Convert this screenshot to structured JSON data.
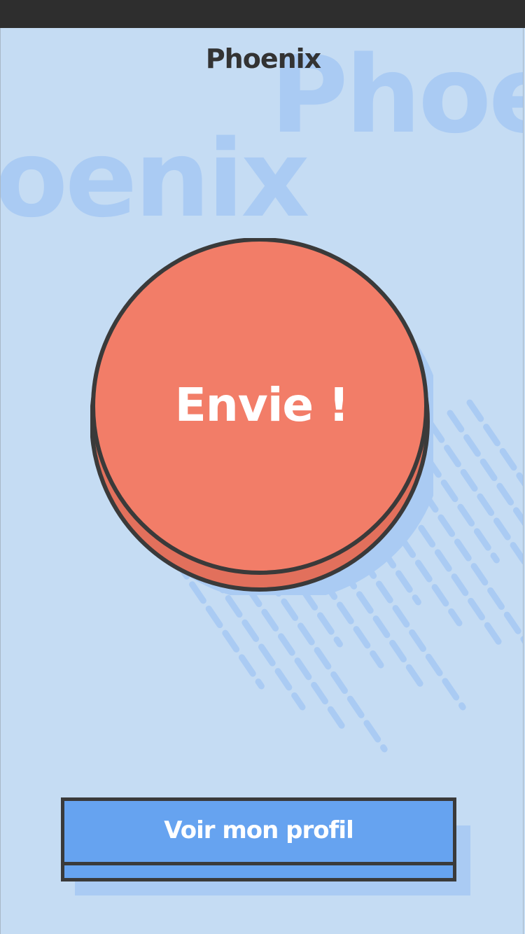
{
  "app": {
    "title": "Phoenix",
    "background_watermark": "Phoenix"
  },
  "main": {
    "envie_button_label": "Envie !",
    "profile_button_label": "Voir mon profil"
  },
  "colors": {
    "background": "#c5dcf3",
    "watermark": "#aacbf3",
    "envie_fill": "#f27d68",
    "envie_side": "#e2705c",
    "outline": "#3a3a3a",
    "profile_fill": "#66a3f0",
    "title_text": "#333333"
  },
  "icons": [
    "speed-lines-decoration"
  ]
}
